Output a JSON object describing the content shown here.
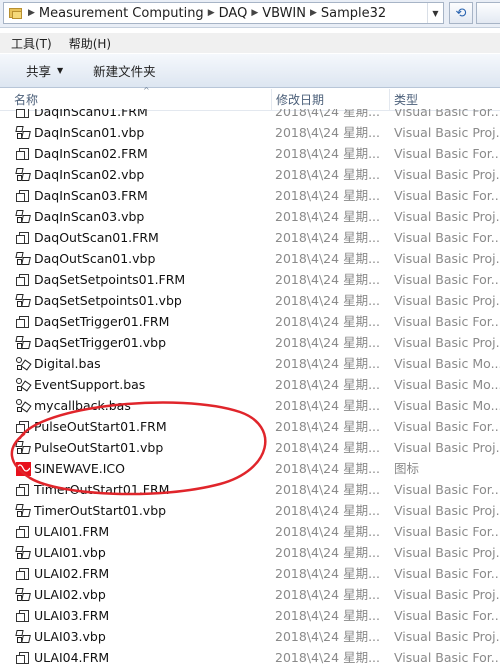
{
  "address": {
    "crumbs": [
      "Measurement Computing",
      "DAQ",
      "VBWIN",
      "Sample32"
    ]
  },
  "menu": {
    "items": [
      "工具(T)",
      "帮助(H)"
    ]
  },
  "toolbar": {
    "share_label": "共享",
    "new_folder_label": "新建文件夹"
  },
  "columns": {
    "name": "名称",
    "date": "修改日期",
    "type": "类型"
  },
  "files": [
    {
      "name": "DaqInScan01.FRM",
      "date": "2018\\4\\24 星期...",
      "type": "Visual Basic For...",
      "icon": "frm-file-icon"
    },
    {
      "name": "DaqInScan01.vbp",
      "date": "2018\\4\\24 星期...",
      "type": "Visual Basic Proj...",
      "icon": "vbp-file-icon"
    },
    {
      "name": "DaqInScan02.FRM",
      "date": "2018\\4\\24 星期...",
      "type": "Visual Basic For...",
      "icon": "frm-file-icon"
    },
    {
      "name": "DaqInScan02.vbp",
      "date": "2018\\4\\24 星期...",
      "type": "Visual Basic Proj...",
      "icon": "vbp-file-icon"
    },
    {
      "name": "DaqInScan03.FRM",
      "date": "2018\\4\\24 星期...",
      "type": "Visual Basic For...",
      "icon": "frm-file-icon"
    },
    {
      "name": "DaqInScan03.vbp",
      "date": "2018\\4\\24 星期...",
      "type": "Visual Basic Proj...",
      "icon": "vbp-file-icon"
    },
    {
      "name": "DaqOutScan01.FRM",
      "date": "2018\\4\\24 星期...",
      "type": "Visual Basic For...",
      "icon": "frm-file-icon"
    },
    {
      "name": "DaqOutScan01.vbp",
      "date": "2018\\4\\24 星期...",
      "type": "Visual Basic Proj...",
      "icon": "vbp-file-icon"
    },
    {
      "name": "DaqSetSetpoints01.FRM",
      "date": "2018\\4\\24 星期...",
      "type": "Visual Basic For...",
      "icon": "frm-file-icon"
    },
    {
      "name": "DaqSetSetpoints01.vbp",
      "date": "2018\\4\\24 星期...",
      "type": "Visual Basic Proj...",
      "icon": "vbp-file-icon"
    },
    {
      "name": "DaqSetTrigger01.FRM",
      "date": "2018\\4\\24 星期...",
      "type": "Visual Basic For...",
      "icon": "frm-file-icon"
    },
    {
      "name": "DaqSetTrigger01.vbp",
      "date": "2018\\4\\24 星期...",
      "type": "Visual Basic Proj...",
      "icon": "vbp-file-icon"
    },
    {
      "name": "Digital.bas",
      "date": "2018\\4\\24 星期...",
      "type": "Visual Basic Mo...",
      "icon": "bas-file-icon"
    },
    {
      "name": "EventSupport.bas",
      "date": "2018\\4\\24 星期...",
      "type": "Visual Basic Mo...",
      "icon": "bas-file-icon"
    },
    {
      "name": "mycallback.bas",
      "date": "2018\\4\\24 星期...",
      "type": "Visual Basic Mo...",
      "icon": "bas-file-icon"
    },
    {
      "name": "PulseOutStart01.FRM",
      "date": "2018\\4\\24 星期...",
      "type": "Visual Basic For...",
      "icon": "frm-file-icon"
    },
    {
      "name": "PulseOutStart01.vbp",
      "date": "2018\\4\\24 星期...",
      "type": "Visual Basic Proj...",
      "icon": "vbp-file-icon"
    },
    {
      "name": "SINEWAVE.ICO",
      "date": "2018\\4\\24 星期...",
      "type": "图标",
      "icon": "ico-file-icon"
    },
    {
      "name": "TimerOutStart01.FRM",
      "date": "2018\\4\\24 星期...",
      "type": "Visual Basic For...",
      "icon": "frm-file-icon"
    },
    {
      "name": "TimerOutStart01.vbp",
      "date": "2018\\4\\24 星期...",
      "type": "Visual Basic Proj...",
      "icon": "vbp-file-icon"
    },
    {
      "name": "ULAI01.FRM",
      "date": "2018\\4\\24 星期...",
      "type": "Visual Basic For...",
      "icon": "frm-file-icon"
    },
    {
      "name": "ULAI01.vbp",
      "date": "2018\\4\\24 星期...",
      "type": "Visual Basic Proj...",
      "icon": "vbp-file-icon"
    },
    {
      "name": "ULAI02.FRM",
      "date": "2018\\4\\24 星期...",
      "type": "Visual Basic For...",
      "icon": "frm-file-icon"
    },
    {
      "name": "ULAI02.vbp",
      "date": "2018\\4\\24 星期...",
      "type": "Visual Basic Proj...",
      "icon": "vbp-file-icon"
    },
    {
      "name": "ULAI03.FRM",
      "date": "2018\\4\\24 星期...",
      "type": "Visual Basic For...",
      "icon": "frm-file-icon"
    },
    {
      "name": "ULAI03.vbp",
      "date": "2018\\4\\24 星期...",
      "type": "Visual Basic Proj...",
      "icon": "vbp-file-icon"
    },
    {
      "name": "ULAI04.FRM",
      "date": "2018\\4\\24 星期...",
      "type": "Visual Basic For...",
      "icon": "frm-file-icon"
    }
  ],
  "annotation": {
    "color": "#e0252b",
    "highlighted_files": [
      "PulseOutStart01.FRM",
      "PulseOutStart01.vbp"
    ]
  }
}
